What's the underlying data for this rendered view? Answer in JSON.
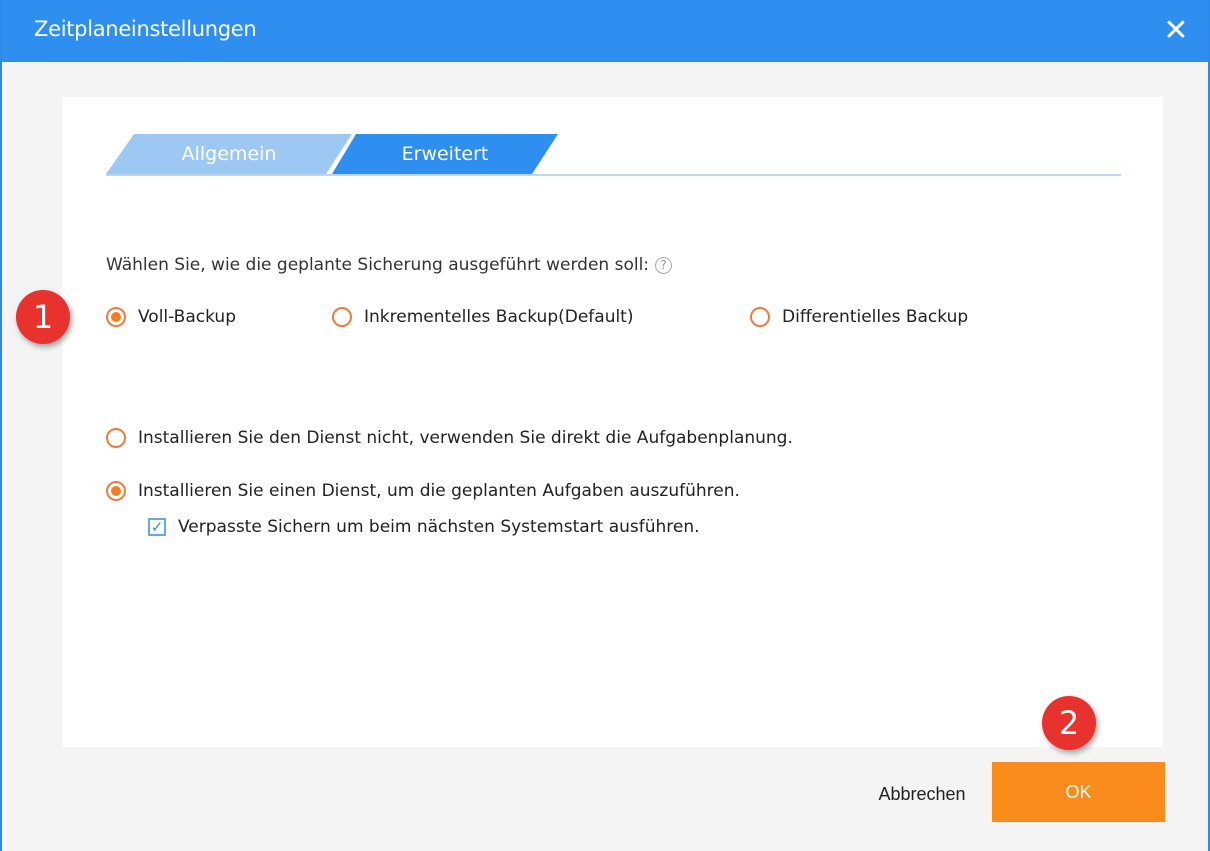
{
  "window": {
    "title": "Zeitplaneinstellungen",
    "close_label": "✕"
  },
  "tabs": [
    {
      "label": "Allgemein",
      "active": false
    },
    {
      "label": "Erweitert",
      "active": true
    }
  ],
  "backup_type": {
    "question": "Wählen Sie, wie die geplante Sicherung ausgeführt werden soll:",
    "help_icon": "?",
    "options": [
      {
        "label": "Voll-Backup",
        "checked": true
      },
      {
        "label": "Inkrementelles Backup(Default)",
        "checked": false
      },
      {
        "label": "Differentielles Backup",
        "checked": false
      }
    ]
  },
  "service": {
    "options": [
      {
        "label": "Installieren Sie den Dienst nicht, verwenden Sie direkt die Aufgabenplanung.",
        "checked": false
      },
      {
        "label": "Installieren Sie einen Dienst, um die geplanten Aufgaben auszuführen.",
        "checked": true
      }
    ],
    "missed_backup": {
      "label": "Verpasste Sichern um beim nächsten Systemstart ausführen.",
      "checked": true,
      "mark": "✓"
    }
  },
  "badges": {
    "first": "1",
    "second": "2"
  },
  "buttons": {
    "cancel": "Abbrechen",
    "ok": "OK"
  },
  "colors": {
    "title_bar": "#2e8ff0",
    "tab_active": "#2e8ff0",
    "tab_inactive": "#9cc8f2",
    "radio": "#f57d1f",
    "ok_button": "#fa8c1d",
    "badge": "#e8322e"
  }
}
